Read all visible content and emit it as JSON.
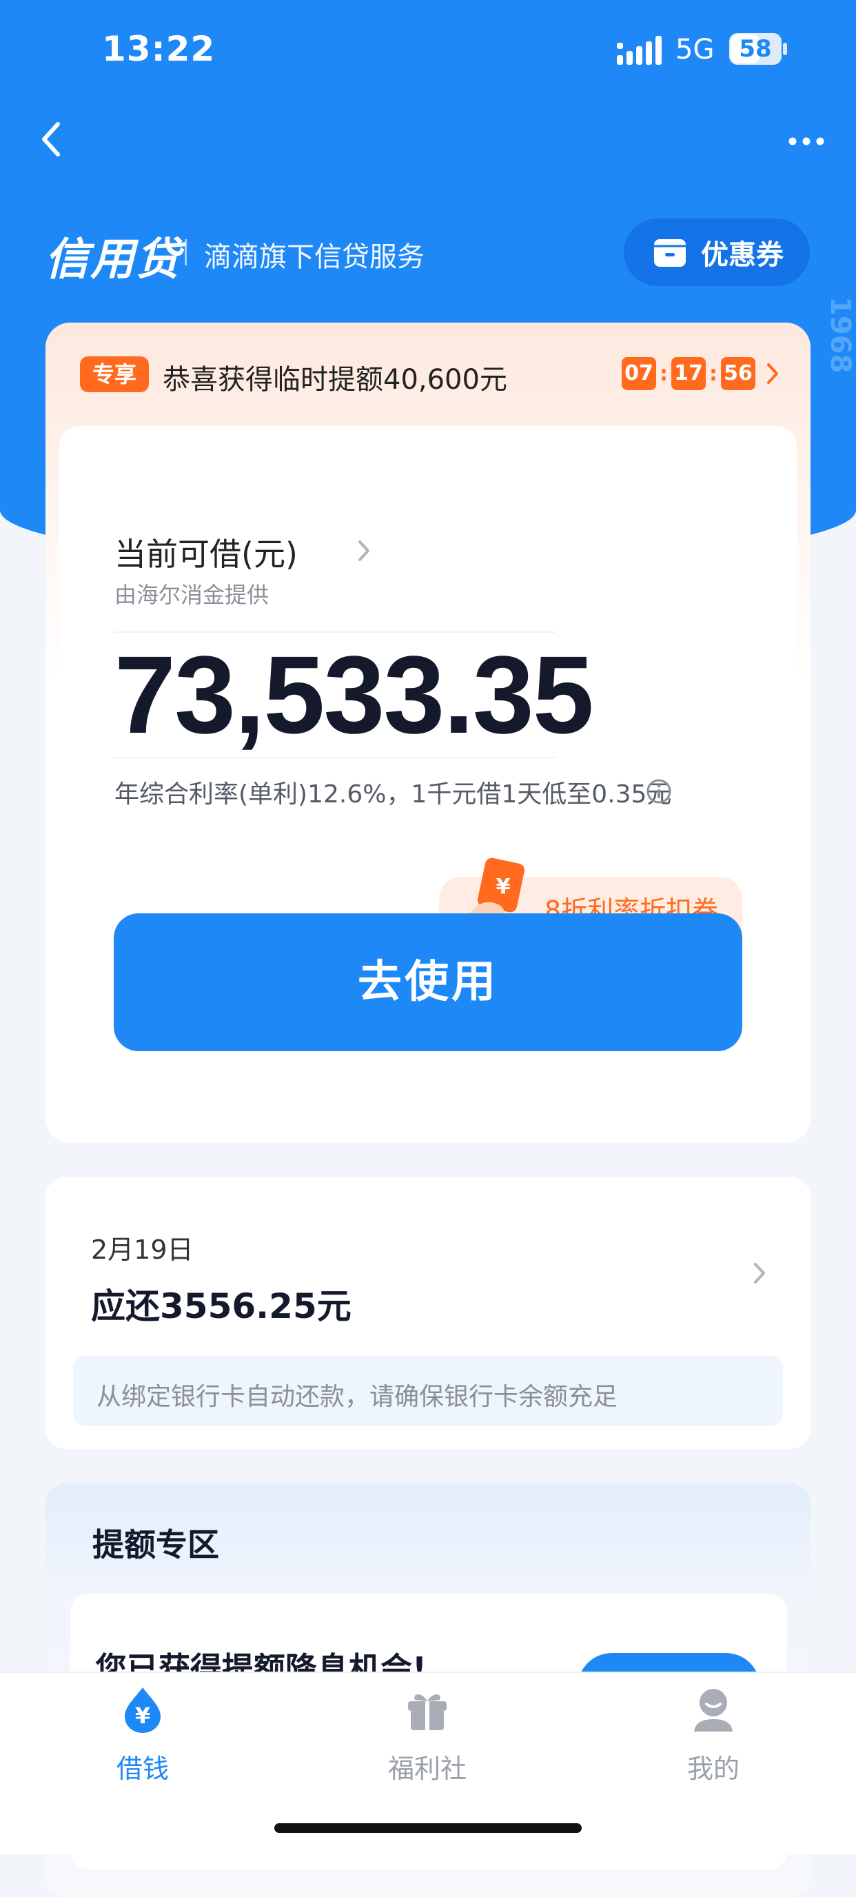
{
  "status_bar": {
    "time": "13:22",
    "network": "5G",
    "battery": "58"
  },
  "header": {
    "title": "信用贷",
    "subtitle": "滴滴旗下信贷服务",
    "coupon_button": "优惠券",
    "side_watermark": "1968"
  },
  "promo": {
    "tag": "专享",
    "text": "恭喜获得临时提额40,600元",
    "timer": {
      "hours": "07",
      "minutes": "17",
      "seconds": "56",
      "separator": ":"
    }
  },
  "credit": {
    "label": "当前可借(元)",
    "provider": "由海尔消金提供",
    "amount": "73,533.35",
    "rate_text": "年综合利率(单利)12.6%，1千元借1天低至0.35元",
    "discount_badge": "8折利率折扣券",
    "use_button": "去使用"
  },
  "repayment": {
    "date": "2月19日",
    "amount": "应还3556.25元",
    "note": "从绑定银行卡自动还款，请确保银行卡余额充足"
  },
  "boost": {
    "title": "提额专区",
    "text": "您已获得提额降息机会!"
  },
  "tabs": [
    {
      "label": "借钱",
      "icon": "money-drop-icon",
      "active": true
    },
    {
      "label": "福利社",
      "icon": "gift-icon",
      "active": false
    },
    {
      "label": "我的",
      "icon": "profile-icon",
      "active": false
    }
  ],
  "colors": {
    "primary": "#1D88F6",
    "accent_orange": "#FF6A1E",
    "inactive_gray": "#9AA0AA"
  }
}
